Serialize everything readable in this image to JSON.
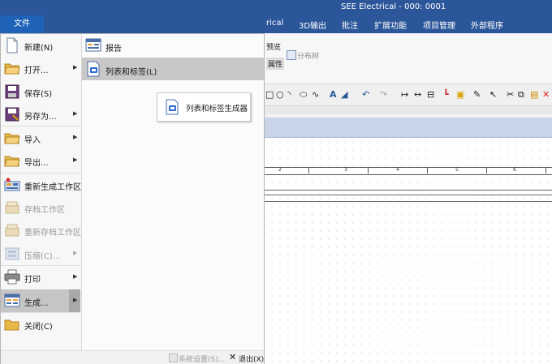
{
  "app": {
    "title": "SEE Electrical - 000: 0001"
  },
  "menubar": {
    "file": "文件",
    "items": [
      "rical",
      "3D输出",
      "批注",
      "扩展功能",
      "项目管理",
      "外部程序"
    ]
  },
  "ribbon": {
    "preview": "预览",
    "properties": "属性",
    "tree": "分布树"
  },
  "canvas": {
    "columns": [
      "2",
      "3",
      "4",
      "5",
      "6"
    ]
  },
  "file_menu": {
    "items": [
      {
        "label": "新建(N)",
        "icon": "new-document-icon",
        "has_submenu": false,
        "disabled": false
      },
      {
        "label": "打开...",
        "icon": "open-folder-icon",
        "has_submenu": true,
        "disabled": false
      },
      {
        "label": "保存(S)",
        "icon": "save-disk-icon",
        "has_submenu": false,
        "disabled": false
      },
      {
        "label": "另存为...",
        "icon": "save-as-icon",
        "has_submenu": true,
        "disabled": false
      },
      {
        "label": "导入",
        "icon": "import-folder-icon",
        "has_submenu": true,
        "disabled": false
      },
      {
        "label": "导出...",
        "icon": "export-folder-icon",
        "has_submenu": true,
        "disabled": false
      },
      {
        "label": "重新生成工作区",
        "icon": "regenerate-workspace-icon",
        "has_submenu": false,
        "disabled": false
      },
      {
        "label": "存档工作区",
        "icon": "archive-workspace-icon",
        "has_submenu": false,
        "disabled": true
      },
      {
        "label": "重新存档工作区",
        "icon": "rearchive-workspace-icon",
        "has_submenu": false,
        "disabled": true
      },
      {
        "label": "压缩(C)...",
        "icon": "compress-icon",
        "has_submenu": true,
        "disabled": true
      },
      {
        "label": "打印",
        "icon": "printer-icon",
        "has_submenu": true,
        "disabled": false
      },
      {
        "label": "生成...",
        "icon": "generate-icon",
        "has_submenu": true,
        "disabled": false,
        "active": true
      },
      {
        "label": "关闭(C)",
        "icon": "close-folder-icon",
        "has_submenu": false,
        "disabled": false
      }
    ],
    "submenu": [
      {
        "label": "报告",
        "icon": "report-icon"
      },
      {
        "label": "列表和标签(L)",
        "icon": "list-label-icon",
        "selected": true
      }
    ],
    "generator_button": "列表和标签生成器",
    "system_settings": "系统设置(S)...",
    "exit": "退出(X)"
  }
}
